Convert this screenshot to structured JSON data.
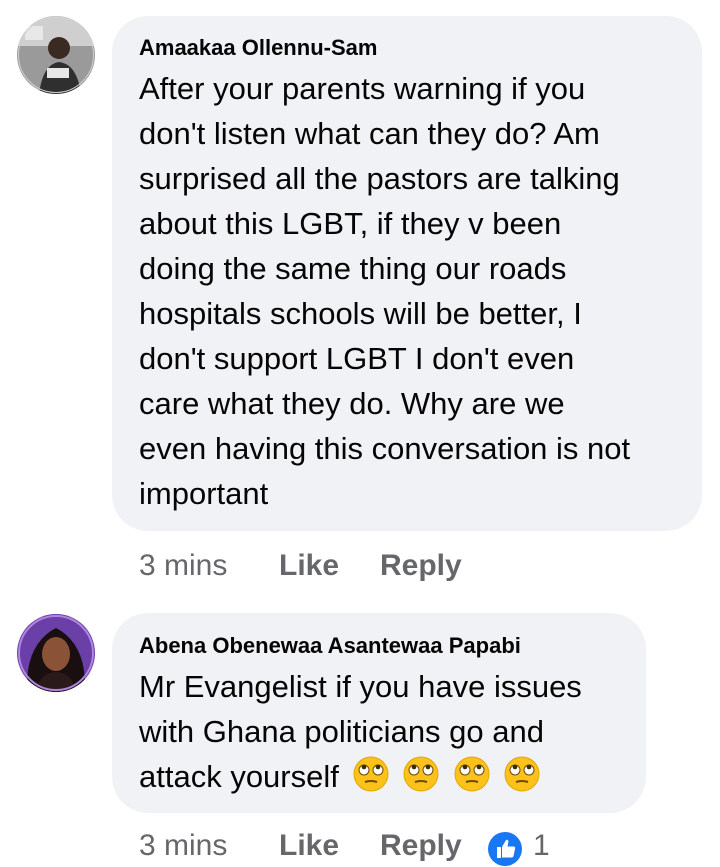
{
  "comments": [
    {
      "author": "Amaakaa Ollennu-Sam",
      "avatar_icon": "profile-photo",
      "lines": [
        "After your parents warning if you",
        "don't listen what can they do? Am",
        "surprised all the pastors are talking",
        "about this LGBT, if they v been",
        "doing the same thing our roads",
        "hospitals schools will be better,  I",
        "don't support LGBT I don't even",
        "care what they do.  Why are we",
        "even having this conversation is not",
        "important"
      ],
      "time": "3 mins",
      "like_label": "Like",
      "reply_label": "Reply"
    },
    {
      "author": "Abena Obenewaa Asantewaa Papabi",
      "avatar_icon": "profile-photo",
      "lines": [
        "Mr Evangelist if you have issues",
        "with Ghana politicians go and",
        "attack yourself"
      ],
      "emojis": [
        "face-with-rolling-eyes",
        "face-with-rolling-eyes",
        "face-with-rolling-eyes",
        "face-with-rolling-eyes"
      ],
      "time": "3 mins",
      "like_label": "Like",
      "reply_label": "Reply",
      "reaction_icon": "like-thumb-icon",
      "reaction_count": "1"
    }
  ],
  "colors": {
    "bubble": "#f0f2f5",
    "meta": "#65676b",
    "like_blue": "#1877f2"
  }
}
